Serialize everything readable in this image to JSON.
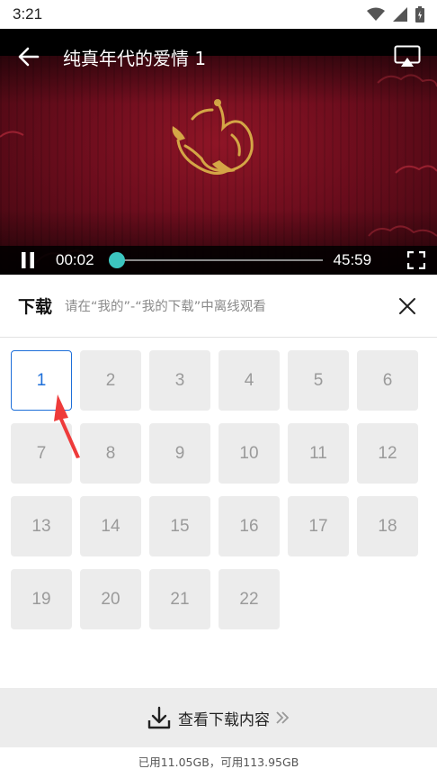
{
  "status_bar": {
    "time": "3:21"
  },
  "player": {
    "title": "纯真年代的爱情 1",
    "current_time": "00:02",
    "duration": "45:59",
    "progress_fraction": 0.0,
    "accent_color": "#3cc6c0"
  },
  "download_panel": {
    "title": "下载",
    "hint": "请在“我的”-“我的下载”中离线观看",
    "episodes": [
      {
        "label": "1",
        "selected": true
      },
      {
        "label": "2",
        "selected": false
      },
      {
        "label": "3",
        "selected": false
      },
      {
        "label": "4",
        "selected": false
      },
      {
        "label": "5",
        "selected": false
      },
      {
        "label": "6",
        "selected": false
      },
      {
        "label": "7",
        "selected": false
      },
      {
        "label": "8",
        "selected": false
      },
      {
        "label": "9",
        "selected": false
      },
      {
        "label": "10",
        "selected": false
      },
      {
        "label": "11",
        "selected": false
      },
      {
        "label": "12",
        "selected": false
      },
      {
        "label": "13",
        "selected": false
      },
      {
        "label": "14",
        "selected": false
      },
      {
        "label": "15",
        "selected": false
      },
      {
        "label": "16",
        "selected": false
      },
      {
        "label": "17",
        "selected": false
      },
      {
        "label": "18",
        "selected": false
      },
      {
        "label": "19",
        "selected": false
      },
      {
        "label": "20",
        "selected": false
      },
      {
        "label": "21",
        "selected": false
      },
      {
        "label": "22",
        "selected": false
      }
    ],
    "selected_color": "#1e6fd9",
    "view_downloads_label": "查看下载内容",
    "storage_text": "已用11.05GB，可用113.95GB"
  },
  "icons": {
    "status": [
      "wifi-icon",
      "signal-icon",
      "battery-icon"
    ],
    "player": [
      "back-arrow-icon",
      "cast-icon",
      "pause-icon",
      "fullscreen-icon"
    ],
    "panel": [
      "close-icon",
      "download-icon",
      "double-chevron-right-icon"
    ],
    "annotation": "red-arrow-pointer-icon"
  }
}
